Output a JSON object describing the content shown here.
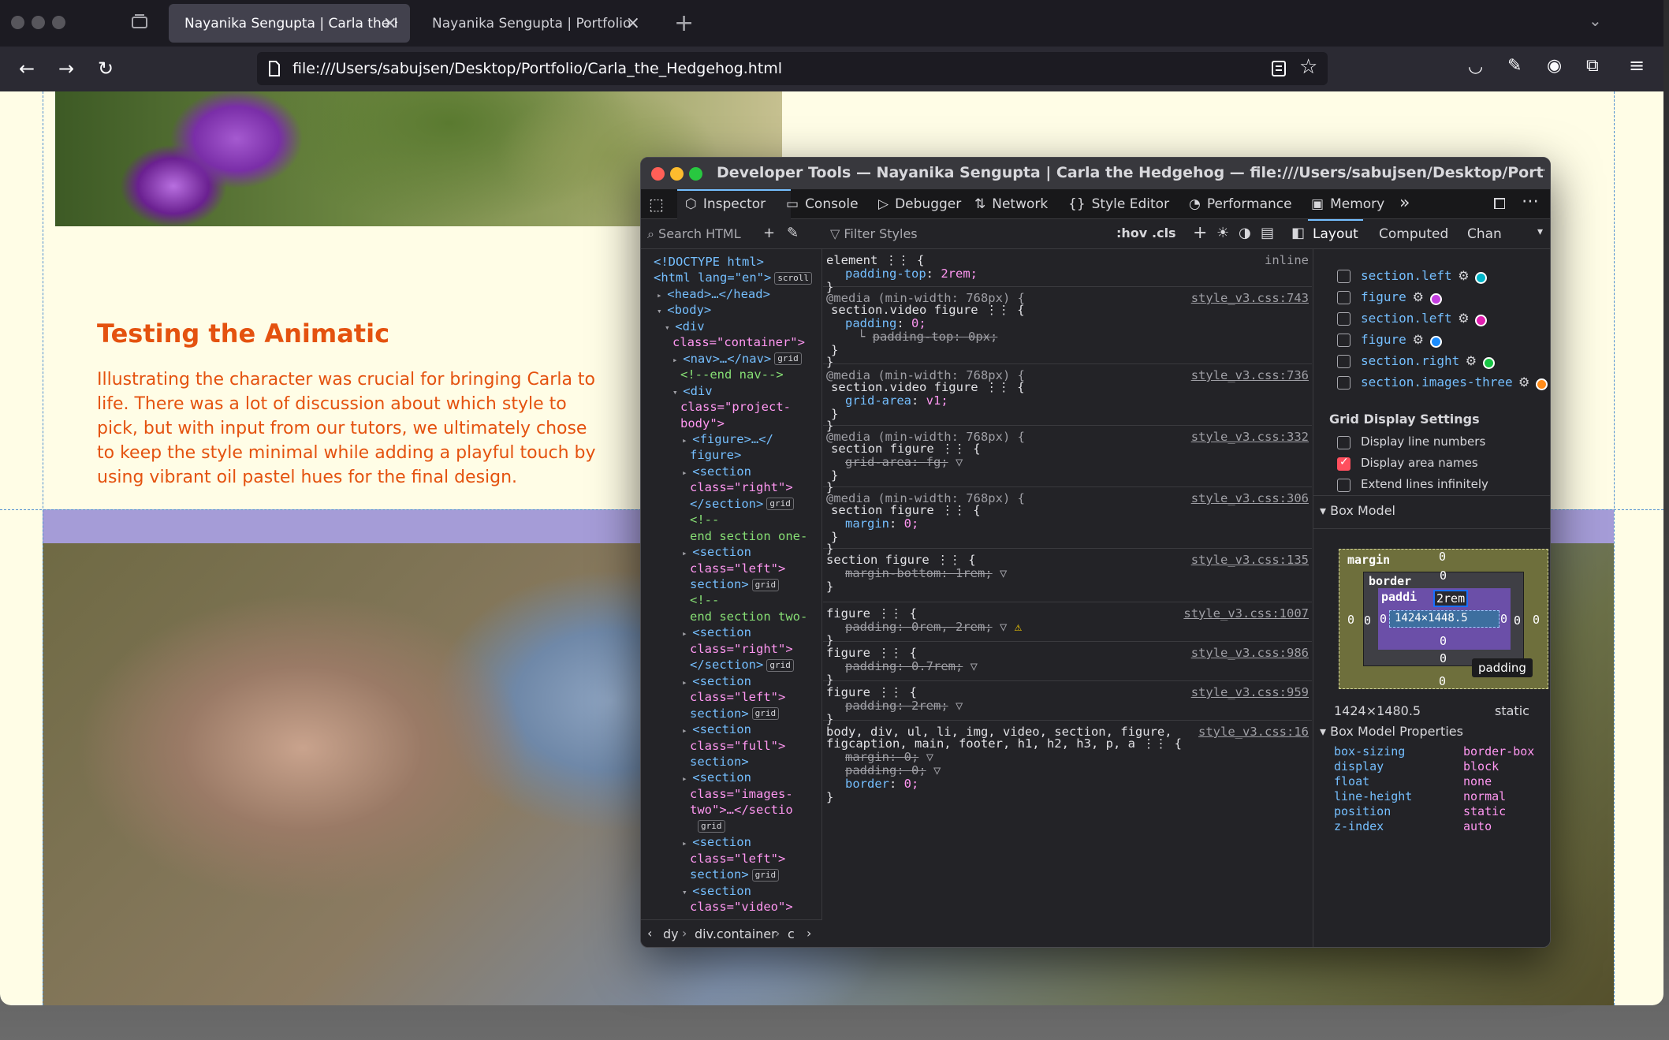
{
  "browser": {
    "tabs": [
      {
        "label": "Nayanika Sengupta | Carla the Hedgehog",
        "active": true
      },
      {
        "label": "Nayanika Sengupta | Portfolio",
        "active": false
      }
    ],
    "url": "file:///Users/sabujsen/Desktop/Portfolio/Carla_the_Hedgehog.html"
  },
  "page": {
    "headline": "Testing the Animatic",
    "paragraph": "Illustrating the character was crucial for bringing Carla to life. There was a lot of discussion about which style to pick, but with input from our tutors, we ultimately chose to keep the style minimal while adding a playful touch by using vibrant oil pastel hues for the final design.",
    "accent_color": "#e4520f",
    "band_color": "#a59cd7"
  },
  "devtools": {
    "title": "Developer Tools — Nayanika Sengupta | Carla the Hedgehog — file:///Users/sabujsen/Desktop/Portfolio/Carla_the_He...",
    "tabs": [
      "Inspector",
      "Console",
      "Debugger",
      "Network",
      "Style Editor",
      "Performance",
      "Memory"
    ],
    "search_html_placeholder": "Search HTML",
    "filter_styles_placeholder": "Filter Styles",
    "hov": ":hov",
    "cls": ".cls",
    "layout_tabs": [
      "Layout",
      "Computed",
      "Chan"
    ],
    "markup": [
      {
        "t": "<!DOCTYPE html>"
      },
      {
        "t": "<html lang=\"en\">",
        "badge": "scroll"
      },
      {
        "t": "<head>…</head>"
      },
      {
        "t": "<body>"
      },
      {
        "t": "<div"
      },
      {
        "t": "class=\"container\">"
      },
      {
        "t": "<nav>…</nav>",
        "badge": "grid"
      },
      {
        "t": "<!--end nav-->"
      },
      {
        "t": "<div"
      },
      {
        "t": "class=\"project-"
      },
      {
        "t": "body\">"
      },
      {
        "t": "<figure>…</"
      },
      {
        "t": "figure>"
      },
      {
        "t": "<section"
      },
      {
        "t": "class=\"right\">"
      },
      {
        "t": "</section>",
        "badge": "grid"
      },
      {
        "t": "<!--"
      },
      {
        "t": "end section one-"
      },
      {
        "t": "<section"
      },
      {
        "t": "class=\"left\">"
      },
      {
        "t": "section>",
        "badge": "grid"
      },
      {
        "t": "<!--"
      },
      {
        "t": "end section two-"
      },
      {
        "t": "<section"
      },
      {
        "t": "class=\"right\">"
      },
      {
        "t": "</section>",
        "badge": "grid"
      },
      {
        "t": "<section"
      },
      {
        "t": "class=\"left\">"
      },
      {
        "t": "section>",
        "badge": "grid"
      },
      {
        "t": "<section"
      },
      {
        "t": "class=\"full\">"
      },
      {
        "t": "section>"
      },
      {
        "t": "<section"
      },
      {
        "t": "class=\"images-"
      },
      {
        "t": "two\">…</sectio"
      },
      {
        "t": "grid"
      },
      {
        "t": "<section"
      },
      {
        "t": "class=\"left\">"
      },
      {
        "t": "section>",
        "badge": "grid"
      },
      {
        "t": "<section"
      },
      {
        "t": "class=\"video\">"
      }
    ],
    "breadcrumb": [
      "dy",
      "div.container",
      "c"
    ],
    "rules": [
      {
        "selector": "element ⋮⋮ {",
        "source": "inline",
        "props": [
          {
            "p": "padding-top",
            "v": "2rem;"
          }
        ]
      },
      {
        "media": "@media (min-width: 768px) {",
        "selector": "section.video figure ⋮⋮ {",
        "source": "style_v3.css:743",
        "props": [
          {
            "p": "padding",
            "v": "0;"
          },
          {
            "p": "padding-top",
            "v": "0px;",
            "struck": true
          }
        ]
      },
      {
        "media": "@media (min-width: 768px) {",
        "selector": "section.video figure ⋮⋮ {",
        "source": "style_v3.css:736",
        "props": [
          {
            "p": "grid-area",
            "v": "v1;"
          }
        ]
      },
      {
        "media": "@media (min-width: 768px) {",
        "selector": "section figure ⋮⋮ {",
        "source": "style_v3.css:332",
        "props": [
          {
            "p": "grid-area",
            "v": "fg;",
            "struck": true
          }
        ]
      },
      {
        "media": "@media (min-width: 768px) {",
        "selector": "section figure ⋮⋮ {",
        "source": "style_v3.css:306",
        "props": [
          {
            "p": "margin",
            "v": "0;"
          }
        ]
      },
      {
        "selector": "section figure ⋮⋮ {",
        "source": "style_v3.css:135",
        "props": [
          {
            "p": "margin-bottom",
            "v": "1rem;",
            "struck": true
          }
        ]
      },
      {
        "selector": "figure ⋮⋮ {",
        "source": "style_v3.css:1007",
        "props": [
          {
            "p": "padding",
            "v": "0rem, 2rem;",
            "struck": true,
            "warn": true
          }
        ]
      },
      {
        "selector": "figure ⋮⋮ {",
        "source": "style_v3.css:986",
        "props": [
          {
            "p": "padding",
            "v": "0.7rem;",
            "struck": true
          }
        ]
      },
      {
        "selector": "figure ⋮⋮ {",
        "source": "style_v3.css:959",
        "props": [
          {
            "p": "padding",
            "v": "2rem;",
            "struck": true
          }
        ]
      },
      {
        "selector": "body, div, ul, li, img, video, section, figure,",
        "selector2": "figcaption, main, footer, h1, h2, h3, p, a ⋮⋮ {",
        "source": "style_v3.css:16",
        "props": [
          {
            "p": "margin",
            "v": "0;",
            "struck": true
          },
          {
            "p": "padding",
            "v": "0;",
            "struck": true
          },
          {
            "p": "border",
            "v": "0;"
          }
        ]
      }
    ],
    "grids": [
      {
        "name": "section.left",
        "color": "#00b5c8"
      },
      {
        "name": "figure",
        "color": "#c43ee0"
      },
      {
        "name": "section.left",
        "color": "#e020b0"
      },
      {
        "name": "figure",
        "color": "#1a8cff"
      },
      {
        "name": "section.right",
        "color": "#17c444"
      },
      {
        "name": "section.images-three",
        "color": "#ff8c1a"
      }
    ],
    "grid_settings_title": "Grid Display Settings",
    "grid_settings": [
      {
        "label": "Display line numbers",
        "checked": false
      },
      {
        "label": "Display area names",
        "checked": true
      },
      {
        "label": "Extend lines infinitely",
        "checked": false
      }
    ],
    "box_model_title": "Box Model",
    "box_model": {
      "margin_label": "margin",
      "border_label": "border",
      "padding_label": "paddi",
      "padding_top": "2rem",
      "content": "1424×1448.5",
      "zero": "0",
      "tooltip": "padding",
      "size": "1424×1480.5",
      "position": "static"
    },
    "box_model_props_title": "Box Model Properties",
    "box_model_props": [
      {
        "p": "box-sizing",
        "v": "border-box"
      },
      {
        "p": "display",
        "v": "block"
      },
      {
        "p": "float",
        "v": "none"
      },
      {
        "p": "line-height",
        "v": "normal"
      },
      {
        "p": "position",
        "v": "static"
      },
      {
        "p": "z-index",
        "v": "auto"
      }
    ]
  }
}
